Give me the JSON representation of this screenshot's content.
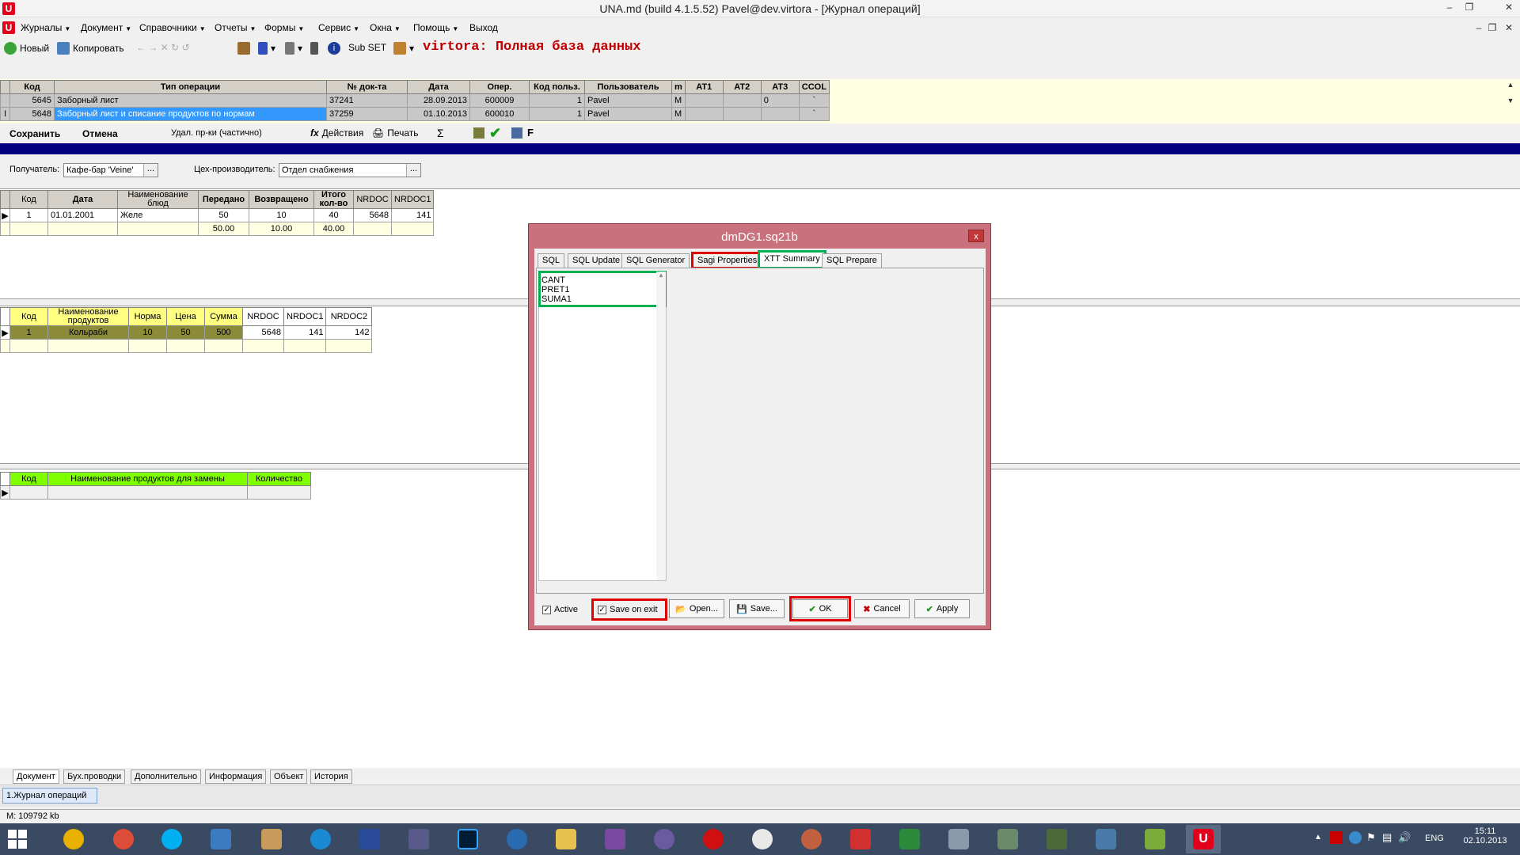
{
  "window": {
    "title": "UNA.md (build 4.1.5.52) Pavel@dev.virtora - [Журнал операций]"
  },
  "menu": [
    "Журналы",
    "Документ",
    "Справочники",
    "Отчеты",
    "Формы",
    "Сервис",
    "Окна",
    "Помощь",
    "Выход"
  ],
  "toolbar": {
    "new": "Новый",
    "copy": "Копировать",
    "subset": "Sub SET",
    "db_title": "virtora: Полная база данных"
  },
  "ops_grid": {
    "headers": [
      "Код",
      "Тип операции",
      "№ док-та",
      "Дата",
      "Опер.",
      "Код польз.",
      "Пользователь",
      "m",
      "AT1",
      "AT2",
      "AT3",
      "CCOL"
    ],
    "rows": [
      [
        "5645",
        "Заборный лист",
        "37241",
        "28.09.2013",
        "600009",
        "1",
        "Pavel",
        "M",
        "",
        "",
        "0",
        "`"
      ],
      [
        "5648",
        "Заборный лист и списание продуктов по нормам",
        "37259",
        "01.10.2013",
        "600010",
        "1",
        "Pavel",
        "M",
        "",
        "",
        "",
        "`"
      ]
    ]
  },
  "actionbar": {
    "save": "Сохранить",
    "cancel": "Отмена",
    "delete_partial": "Удал. пр-ки  (частично)",
    "actions": "Действия",
    "print": "Печать",
    "sigma": "Σ",
    "f_label": "F"
  },
  "form": {
    "recipient_label": "Получатель:",
    "recipient_value": "Кафе-бар 'Veine'",
    "workshop_label": "Цех-производитель:",
    "workshop_value": "Отдел снабжения"
  },
  "grid1": {
    "headers": [
      "Код",
      "Дата",
      "Наименование блюд",
      "Передано",
      "Возвращено",
      "Итого кол-во",
      "NRDOC",
      "NRDOC1"
    ],
    "rows": [
      [
        "1",
        "01.01.2001",
        "Желе",
        "50",
        "10",
        "40",
        "5648",
        "141"
      ]
    ],
    "totals": [
      "",
      "",
      "",
      "50.00",
      "10.00",
      "40.00",
      "",
      ""
    ]
  },
  "grid2": {
    "headers": [
      "Код",
      "Наименование продуктов",
      "Норма",
      "Цена",
      "Сумма",
      "NRDOC",
      "NRDOC1",
      "NRDOC2"
    ],
    "rows": [
      [
        "1",
        "Кольраби",
        "10",
        "50",
        "500",
        "5648",
        "141",
        "142"
      ]
    ]
  },
  "grid3": {
    "headers": [
      "Код",
      "Наименование продуктов для замены",
      "Количество"
    ]
  },
  "dialog": {
    "title": "dmDG1.sq21b",
    "close": "x",
    "tabs": [
      "SQL",
      "SQL Update",
      "SQL Generator",
      "Sagi Properties",
      "XTT Summary",
      "SQL Prepare"
    ],
    "list": [
      "CANT",
      "PRET1",
      "SUMA1"
    ],
    "active_label": "Active",
    "save_on_exit_label": "Save on exit",
    "buttons": {
      "open": "Open...",
      "save": "Save...",
      "ok": "OK",
      "cancel": "Cancel",
      "apply": "Apply"
    }
  },
  "bottom_tabs": [
    "Документ",
    "Бух.проводки",
    "Дополнительно",
    "Информация",
    "Объект",
    "История"
  ],
  "window_tab": "1.Журнал операций",
  "status": {
    "memory": "M: 109792 kb"
  },
  "tray": {
    "lang": "ENG",
    "time": "15:11",
    "date": "02.10.2013"
  }
}
